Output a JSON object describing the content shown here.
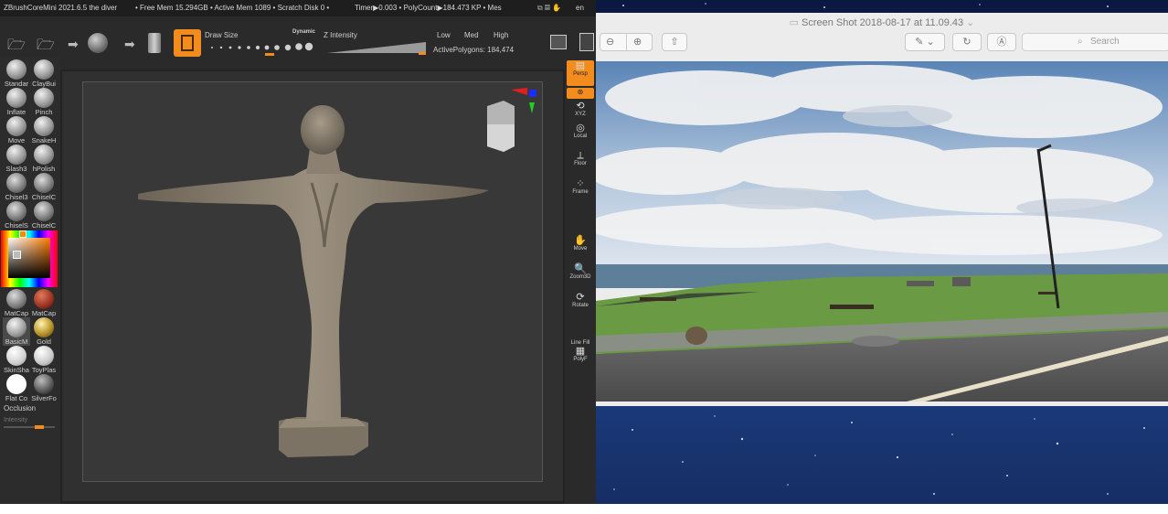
{
  "zbrush": {
    "title": {
      "app": "ZBrushCoreMini 2021.6.5 the diver",
      "free_mem": "• Free Mem 15.294GB • Active Mem 1089 • Scratch Disk 0 •",
      "timer": "Timer▶0.003 • PolyCount▶184.473 KP • Mes",
      "lang": "en"
    },
    "toolbar": {
      "draw_size_label": "Draw Size",
      "dynamic_label": "Dynamic",
      "z_intensity_label": "Z Intensity",
      "low": "Low",
      "med": "Med",
      "high": "High",
      "active_polygons": "ActivePolygons: 184,474"
    },
    "brushes": [
      {
        "label": "Standar"
      },
      {
        "label": "ClayBui"
      },
      {
        "label": "Inflate"
      },
      {
        "label": "Pinch"
      },
      {
        "label": "Move"
      },
      {
        "label": "SnakeH"
      },
      {
        "label": "Slash3"
      },
      {
        "label": "hPolish"
      },
      {
        "label": "Chisel3"
      },
      {
        "label": "ChiselC"
      },
      {
        "label": "ChiselS"
      },
      {
        "label": "ChiselC"
      }
    ],
    "materials": [
      {
        "label": "MatCap",
        "color": "#8a8a8a"
      },
      {
        "label": "MatCap",
        "color": "#9a3020"
      },
      {
        "label": "BasicM",
        "color": "#bbbbbb"
      },
      {
        "label": "Gold",
        "color": "#b8952a"
      },
      {
        "label": "SkinSha",
        "color": "#e6e6e6"
      },
      {
        "label": "ToyPlas",
        "color": "#dcdcdc"
      },
      {
        "label": "Flat Co",
        "color": "#ffffff"
      },
      {
        "label": "SilverFo",
        "color": "#555555"
      }
    ],
    "occlusion_label": "Occlusion",
    "intensity_label": "Intensity",
    "right_panel": [
      {
        "label": "Persp",
        "icon": "persp-icon"
      },
      {
        "label": "XYZ",
        "icon": "xyz-icon"
      },
      {
        "label": "Local",
        "icon": "local-icon"
      },
      {
        "label": "Floor",
        "icon": "floor-icon"
      },
      {
        "label": "Frame",
        "icon": "frame-icon"
      },
      {
        "label": "Move",
        "icon": "move-hand-icon"
      },
      {
        "label": "Zoom3D",
        "icon": "zoom3d-icon"
      },
      {
        "label": "Rotate",
        "icon": "rotate-icon"
      },
      {
        "label": "Line Fill",
        "icon": "line-fill-icon"
      },
      {
        "label": "PolyF",
        "icon": "polyf-icon"
      }
    ],
    "colors": {
      "accent": "#f28c1e",
      "model": "#8a7f6e",
      "canvas": "#383838"
    }
  },
  "preview": {
    "title": "Screen Shot 2018-08-17 at 11.09.43",
    "search_placeholder": "Search"
  }
}
